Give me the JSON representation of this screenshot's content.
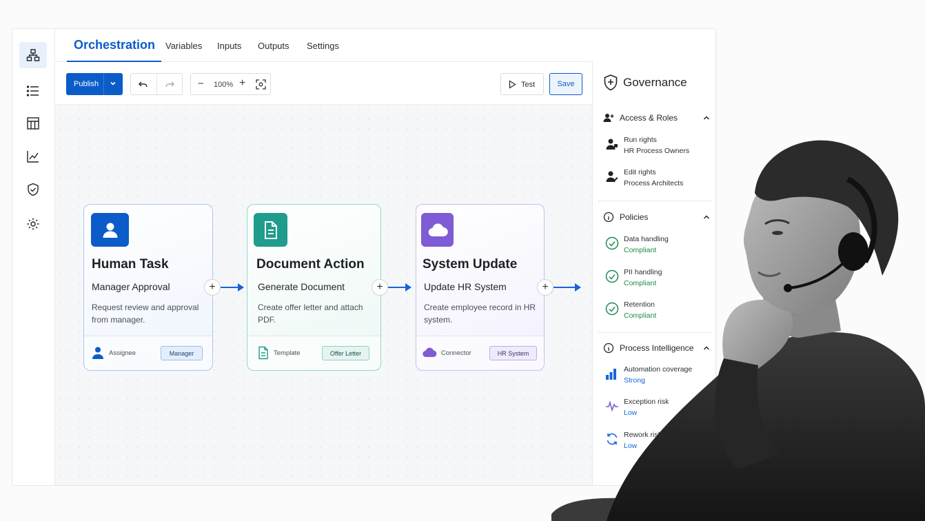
{
  "tabs": [
    "Orchestration",
    "Variables",
    "Inputs",
    "Outputs",
    "Settings"
  ],
  "toolbar": {
    "publish_label": "Publish",
    "zoom_value": "100%",
    "test_label": "Test",
    "save_label": "Save"
  },
  "rail_icons": [
    "flow-icon",
    "list-icon",
    "table-icon",
    "chart-icon",
    "shield-icon",
    "gear-icon"
  ],
  "cards": [
    {
      "title": "Human Task",
      "subtitle": "Manager Approval",
      "description": "Request review and approval from manager.",
      "footer_label": "Assignee",
      "footer_value": "Manager",
      "icon": "user-icon",
      "accent": "#0b5cc9"
    },
    {
      "title": "Document Action",
      "subtitle": "Generate Document",
      "description": "Create offer letter and attach PDF.",
      "footer_label": "Template",
      "footer_value": "Offer Letter",
      "icon": "document-icon",
      "accent": "#1f9c8c"
    },
    {
      "title": "System Update",
      "subtitle": "Update HR System",
      "description": "Create employee record in HR system.",
      "footer_label": "Connector",
      "footer_value": "HR System",
      "icon": "cloud-icon",
      "accent": "#7f5bd6"
    }
  ],
  "governance": {
    "title": "Governance",
    "access": {
      "title": "Access & Roles",
      "items": [
        {
          "label": "Run rights",
          "value": "HR Process Owners"
        },
        {
          "label": "Edit rights",
          "value": "Process Architects"
        }
      ]
    },
    "policies": {
      "title": "Policies",
      "items": [
        {
          "label": "Data handling",
          "value": "Compliant"
        },
        {
          "label": "PII handling",
          "value": "Compliant"
        },
        {
          "label": "Retention",
          "value": "Compliant"
        }
      ]
    },
    "intelligence": {
      "title": "Process Intelligence",
      "items": [
        {
          "label": "Automation coverage",
          "value": "Strong"
        },
        {
          "label": "Exception risk",
          "value": "Low"
        },
        {
          "label": "Rework risk",
          "value": "Low"
        }
      ]
    }
  }
}
